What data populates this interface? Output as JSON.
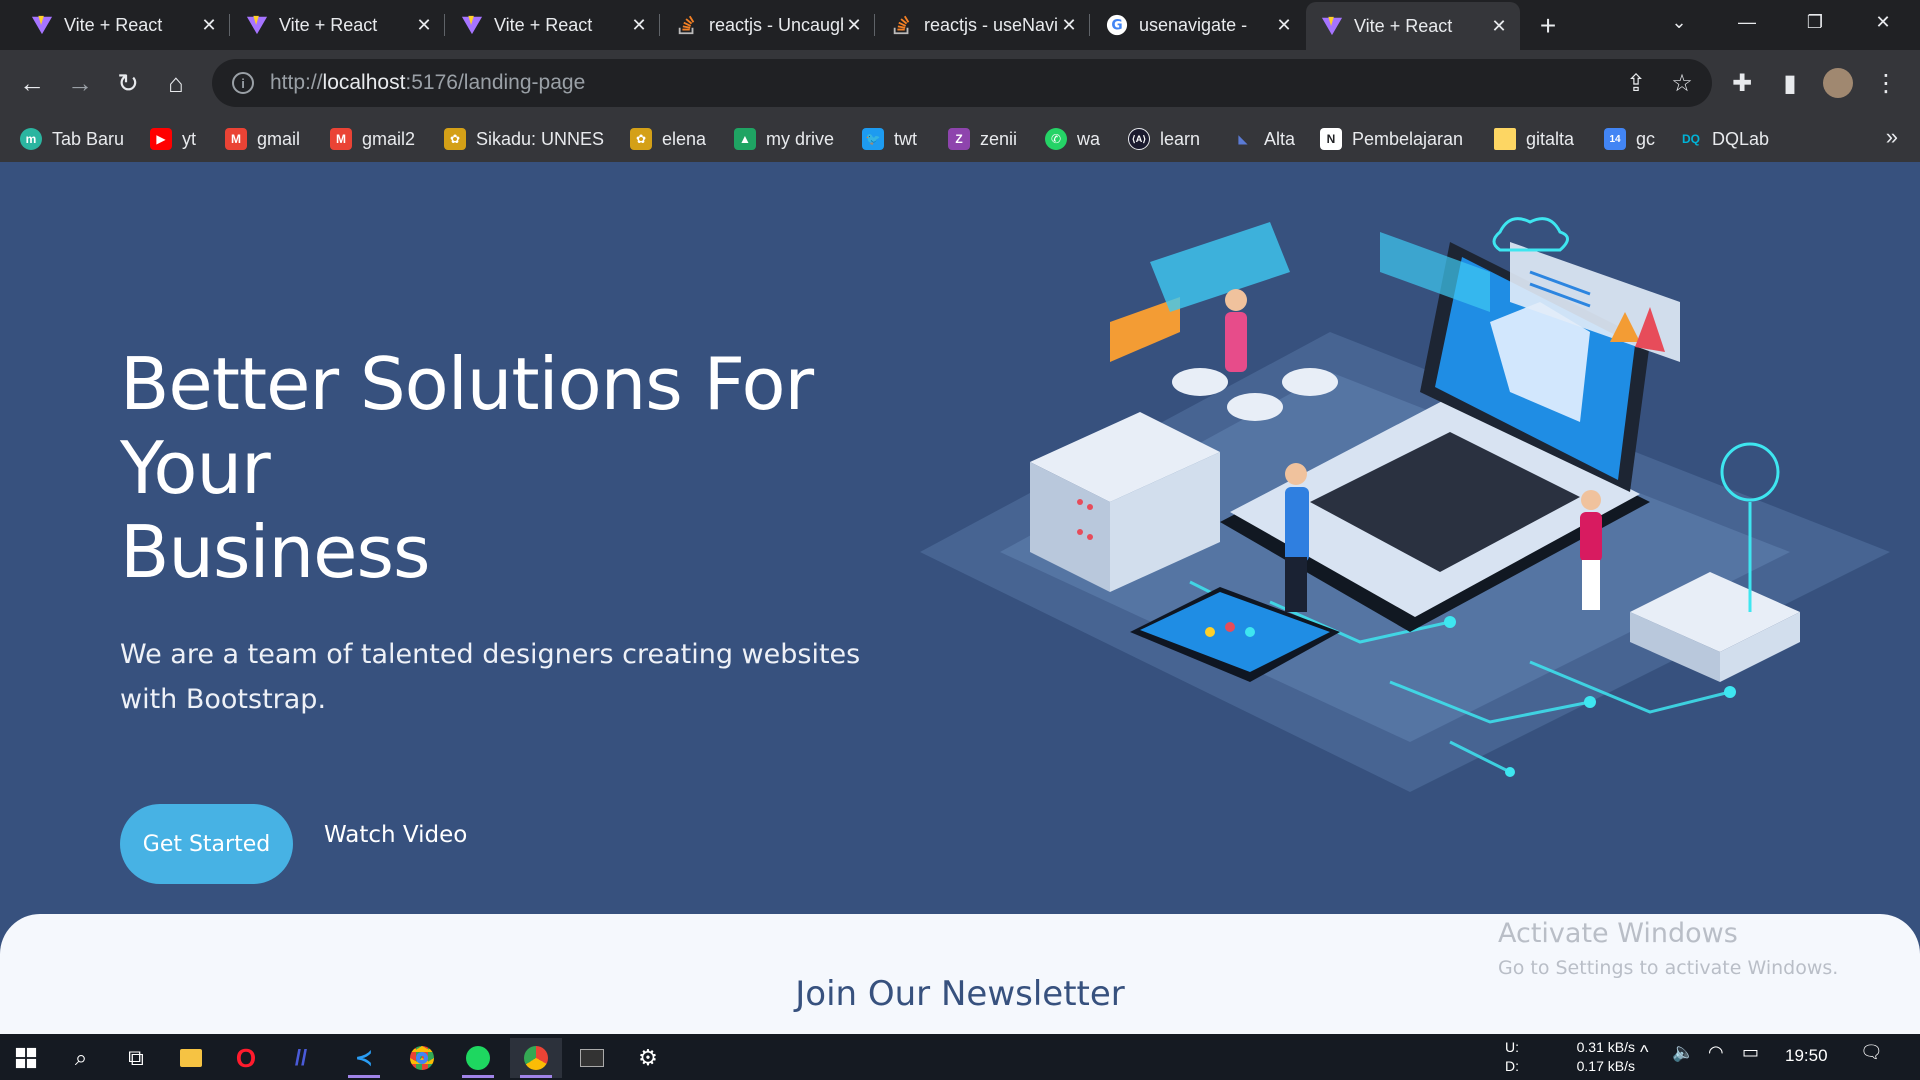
{
  "tabs": [
    {
      "label": "Vite + React",
      "icon": "vite-icon"
    },
    {
      "label": "Vite + React",
      "icon": "vite-icon"
    },
    {
      "label": "Vite + React",
      "icon": "vite-icon"
    },
    {
      "label": "reactjs - Uncaught",
      "icon": "stackoverflow-icon"
    },
    {
      "label": "reactjs - useNavigate",
      "icon": "stackoverflow-icon"
    },
    {
      "label": "usenavigate -",
      "icon": "google-icon"
    },
    {
      "label": "Vite + React",
      "icon": "vite-icon",
      "active": true
    }
  ],
  "address_bar": {
    "scheme": "http://",
    "host": "localhost",
    "rest": ":5176/landing-page"
  },
  "bookmarks": [
    {
      "label": "Tab Baru",
      "icon": "tab-baru-icon",
      "color": "#2bb5a0",
      "glyph": "m"
    },
    {
      "label": "yt",
      "icon": "youtube-icon",
      "color": "#ff0000",
      "glyph": "▶"
    },
    {
      "label": "gmail",
      "icon": "gmail-icon",
      "color": "#ea4335",
      "glyph": "M"
    },
    {
      "label": "gmail2",
      "icon": "gmail-icon",
      "color": "#ea4335",
      "glyph": "M"
    },
    {
      "label": "Sikadu: UNNES",
      "icon": "unnes-icon",
      "color": "#d4a017",
      "glyph": "✿"
    },
    {
      "label": "elena",
      "icon": "unnes-icon",
      "color": "#d4a017",
      "glyph": "✿"
    },
    {
      "label": "my drive",
      "icon": "google-drive-icon",
      "color": "#1fa463",
      "glyph": "▲"
    },
    {
      "label": "twt",
      "icon": "twitter-icon",
      "color": "#1d9bf0",
      "glyph": "🐦"
    },
    {
      "label": "zenii",
      "icon": "zenius-icon",
      "color": "#8e44ad",
      "glyph": "Z"
    },
    {
      "label": "wa",
      "icon": "whatsapp-icon",
      "color": "#25d366",
      "glyph": "✆"
    },
    {
      "label": "learn",
      "icon": "learn-icon",
      "color": "#1a1a2e",
      "glyph": "⟨A⟩"
    },
    {
      "label": "Alta",
      "icon": "alta-icon",
      "color": "#3b5998",
      "glyph": "◣"
    },
    {
      "label": "Pembelajaran",
      "icon": "notion-icon",
      "color": "#ffffff",
      "glyph": "N"
    },
    {
      "label": "gitalta",
      "icon": "folder-icon",
      "color": "#fdd663",
      "glyph": ""
    },
    {
      "label": "gc",
      "icon": "google-calendar-icon",
      "color": "#4285f4",
      "glyph": "14"
    },
    {
      "label": "DQLab",
      "icon": "dqlab-icon",
      "color": "#00b4d8",
      "glyph": "DQ"
    }
  ],
  "hero": {
    "title_line1": "Better Solutions For",
    "title_line2": "Your",
    "title_line3": "Business",
    "subtitle": "We are a team of talented designers creating websites with Bootstrap.",
    "cta_primary": "Get Started",
    "cta_secondary": "Watch Video"
  },
  "newsletter": {
    "title": "Join Our Newsletter"
  },
  "watermark": {
    "line1": "Activate Windows",
    "line2": "Go to Settings to activate Windows."
  },
  "taskbar": {
    "net_up_label": "U:",
    "net_down_label": "D:",
    "net_up": "0.31 kB/s",
    "net_down": "0.17 kB/s",
    "time": "19:50"
  },
  "colors": {
    "hero_bg": "#37517e",
    "accent": "#47b2e4",
    "newsletter_bg": "#f5f8fd"
  }
}
